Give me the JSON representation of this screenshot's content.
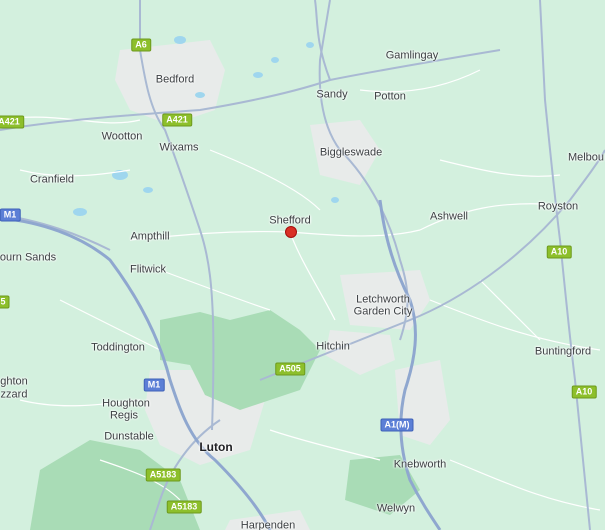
{
  "map": {
    "colors": {
      "land": "#d3f0de",
      "urban": "#e8ebea",
      "forest": "#a9dcb6",
      "water": "#9fd6ee",
      "motorway": "#8fa7cf",
      "a_road": "#a9b9d3",
      "minor_road": "#ffffff",
      "pin": "#d93025"
    },
    "places": [
      {
        "name": "Bedford",
        "major": false
      },
      {
        "name": "Gamlingay",
        "major": false
      },
      {
        "name": "Sandy",
        "major": false
      },
      {
        "name": "Potton",
        "major": false
      },
      {
        "name": "Wootton",
        "major": false
      },
      {
        "name": "Wixams",
        "major": false
      },
      {
        "name": "Biggleswade",
        "major": false
      },
      {
        "name": "Melbou",
        "major": false
      },
      {
        "name": "Cranfield",
        "major": false
      },
      {
        "name": "Ashwell",
        "major": false
      },
      {
        "name": "Royston",
        "major": false
      },
      {
        "name": "Shefford",
        "major": false
      },
      {
        "name": "Ampthill",
        "major": false
      },
      {
        "name": "ourn Sands",
        "major": false
      },
      {
        "name": "Flitwick",
        "major": false
      },
      {
        "name": "Letchworth",
        "major": false
      },
      {
        "name": "Garden City",
        "major": false
      },
      {
        "name": "Toddington",
        "major": false
      },
      {
        "name": "Hitchin",
        "major": false
      },
      {
        "name": "Buntingford",
        "major": false
      },
      {
        "name": "ghton",
        "major": false
      },
      {
        "name": "zzard",
        "major": false
      },
      {
        "name": "Houghton",
        "major": false
      },
      {
        "name": "Regis",
        "major": false
      },
      {
        "name": "Dunstable",
        "major": false
      },
      {
        "name": "Luton",
        "major": true
      },
      {
        "name": "Knebworth",
        "major": false
      },
      {
        "name": "Welwyn",
        "major": false
      },
      {
        "name": "Harpenden",
        "major": false
      }
    ],
    "shields": [
      {
        "label": "A6",
        "type": "green"
      },
      {
        "label": "A421",
        "type": "green"
      },
      {
        "label": "A421",
        "type": "green"
      },
      {
        "label": "M1",
        "type": "blue"
      },
      {
        "label": "5",
        "type": "green"
      },
      {
        "label": "A10",
        "type": "green"
      },
      {
        "label": "A505",
        "type": "green"
      },
      {
        "label": "M1",
        "type": "blue"
      },
      {
        "label": "A10",
        "type": "green"
      },
      {
        "label": "A1(M)",
        "type": "blue"
      },
      {
        "label": "A5183",
        "type": "green"
      },
      {
        "label": "A5183",
        "type": "green"
      }
    ],
    "marker": {
      "label": "Shefford"
    }
  }
}
